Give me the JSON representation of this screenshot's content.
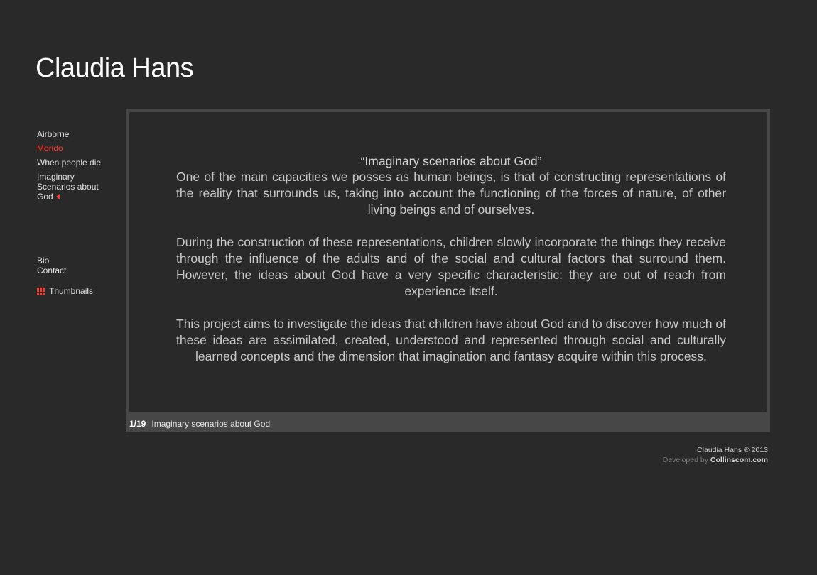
{
  "site": {
    "title": "Claudia Hans"
  },
  "nav": {
    "items": [
      {
        "label": "Airborne",
        "active": false
      },
      {
        "label": "Morido",
        "active": true
      },
      {
        "label": "When people die",
        "active": false
      },
      {
        "label": "Imaginary Scenarios about God",
        "active": true,
        "current": true
      }
    ],
    "secondary": [
      "Bio",
      "Contact"
    ],
    "thumbnails_label": "Thumbnails",
    "thumbnails_icon": "grid-icon"
  },
  "slide": {
    "heading": "“Imaginary scenarios about God”",
    "paragraphs": [
      "One of the main capacities we posses as human beings, is that of constructing representations of the reality that surrounds us, taking into account the functioning of the forces of nature, of other living beings and of ourselves.",
      "During the construction of these representations, children slowly incorporate the things they receive through the influence of the adults and of the social and cultural factors that surround them. However, the ideas about God have a very specific characteristic: they are out of reach from experience itself.",
      "This project aims to investigate the ideas that children have about God and to discover how much of these ideas are assimilated, created, understood and represented through social and culturally learned concepts and the dimension that imagination and fantasy acquire within this process."
    ],
    "counter": "1/19",
    "caption": "Imaginary scenarios about God"
  },
  "footer": {
    "copyright": "Claudia Hans ® 2013",
    "developed_by": "Developed by",
    "developer": "Collinscom.com"
  },
  "colors": {
    "background": "#292929",
    "accent": "#ff3b30",
    "frame": "#474747"
  }
}
